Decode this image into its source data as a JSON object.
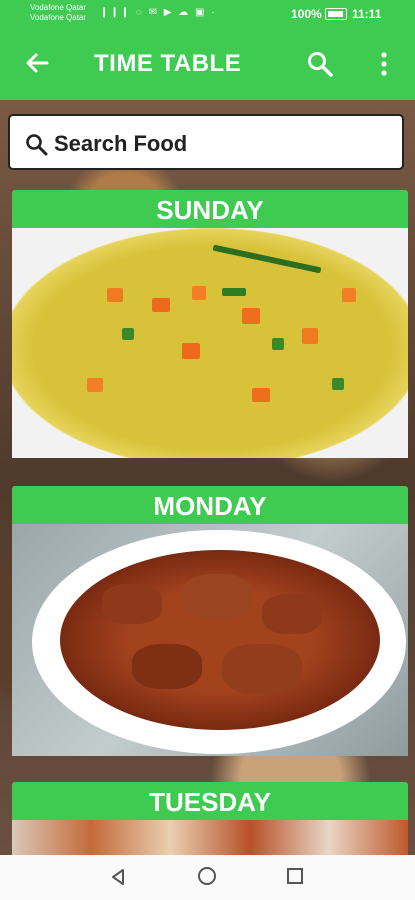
{
  "status_bar": {
    "carrier_1": "Vodafone Qatar",
    "carrier_2": "Vodafone Qatar",
    "icons": "❙❙❙ ◌ ✉ ▶ ☁ ▣ ·",
    "battery_percent": "100%",
    "time": "11:11"
  },
  "app_bar": {
    "title": "TIME TABLE",
    "back_icon": "arrow-left-icon",
    "search_icon": "search-icon",
    "more_icon": "more-vert-icon",
    "color": "#3fca52"
  },
  "search": {
    "placeholder": "Search Food",
    "value": ""
  },
  "days": [
    {
      "label": "SUNDAY"
    },
    {
      "label": "MONDAY"
    },
    {
      "label": "TUESDAY"
    }
  ]
}
